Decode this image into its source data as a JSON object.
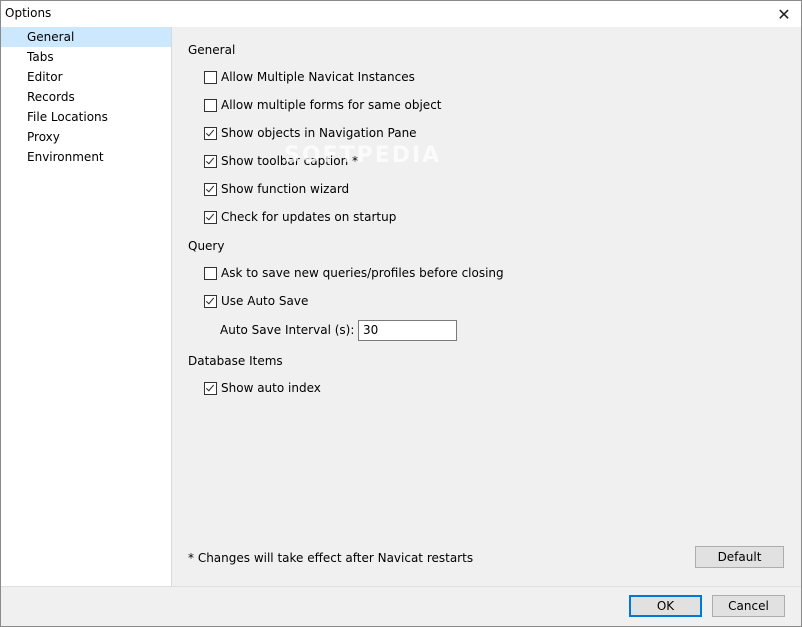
{
  "window": {
    "title": "Options"
  },
  "sidebar": {
    "items": [
      {
        "label": "General"
      },
      {
        "label": "Tabs"
      },
      {
        "label": "Editor"
      },
      {
        "label": "Records"
      },
      {
        "label": "File Locations"
      },
      {
        "label": "Proxy"
      },
      {
        "label": "Environment"
      }
    ]
  },
  "general": {
    "heading": "General",
    "options": [
      {
        "label": "Allow Multiple Navicat Instances",
        "checked": false
      },
      {
        "label": "Allow multiple forms for same object",
        "checked": false
      },
      {
        "label": "Show objects in Navigation Pane",
        "checked": true
      },
      {
        "label": "Show toolbar caption *",
        "checked": true
      },
      {
        "label": "Show function wizard",
        "checked": true
      },
      {
        "label": "Check for updates on startup",
        "checked": true
      }
    ]
  },
  "query": {
    "heading": "Query",
    "options": [
      {
        "label": "Ask to save new queries/profiles before closing",
        "checked": false
      },
      {
        "label": "Use Auto Save",
        "checked": true
      }
    ],
    "interval_label": "Auto Save Interval (s):",
    "interval_value": "30"
  },
  "database_items": {
    "heading": "Database Items",
    "options": [
      {
        "label": "Show auto index",
        "checked": true
      }
    ]
  },
  "note": "* Changes will take effect after Navicat restarts",
  "buttons": {
    "default": "Default",
    "ok": "OK",
    "cancel": "Cancel"
  },
  "watermark": "SOFTPEDIA"
}
